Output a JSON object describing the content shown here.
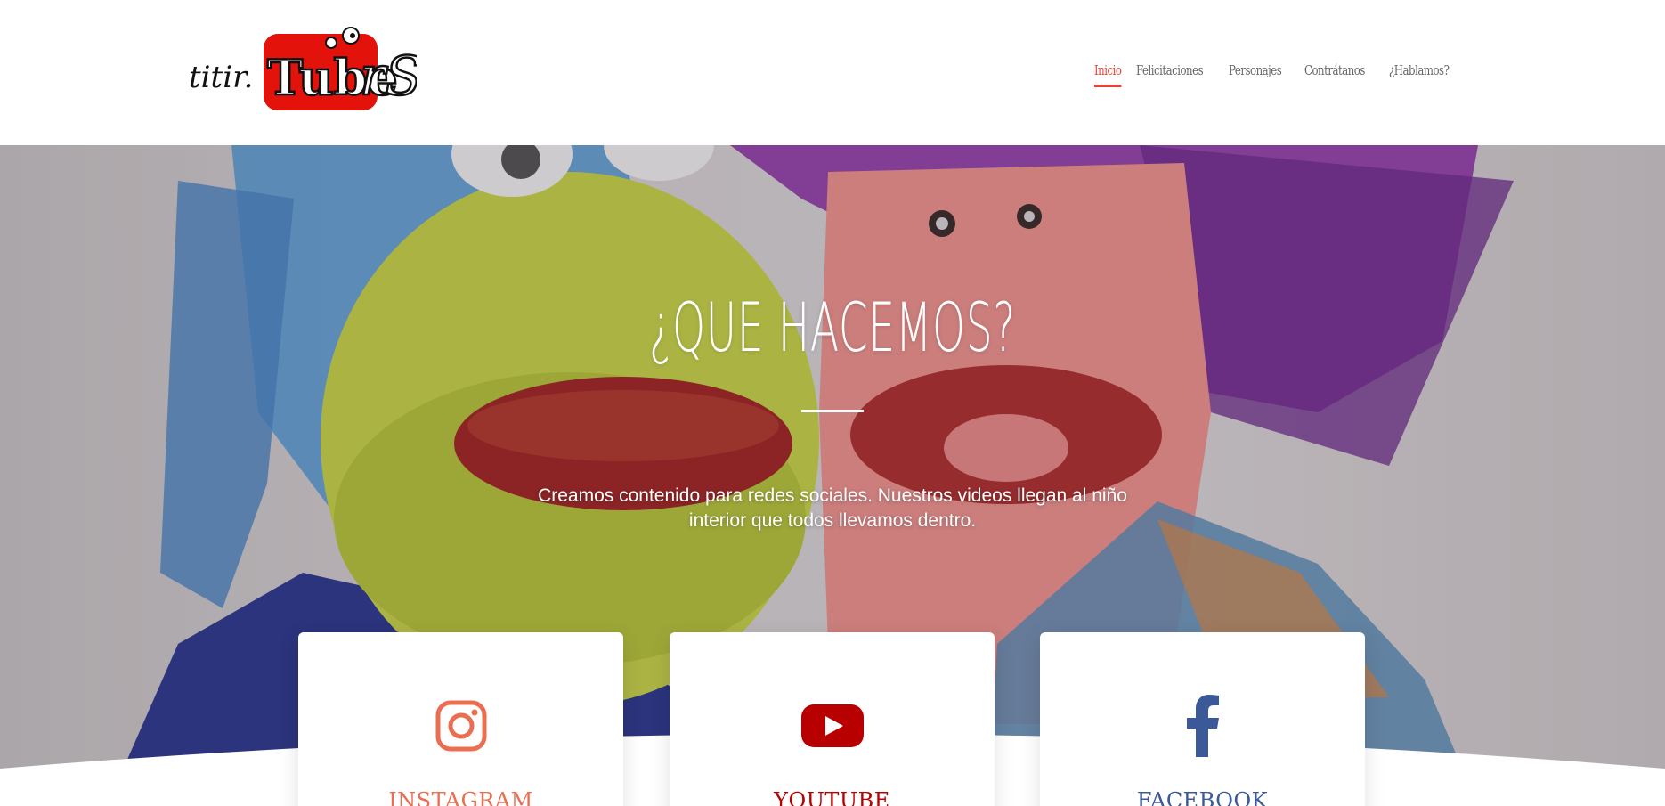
{
  "header": {
    "logo_alt": "Titiritubers",
    "nav": [
      {
        "label": "Inicio",
        "active": true
      },
      {
        "label": "Felicitaciones",
        "active": false
      },
      {
        "label": "Personajes",
        "active": false
      },
      {
        "label": "Contrátanos",
        "active": false
      },
      {
        "label": "¿Hablamos?",
        "active": false
      }
    ],
    "accent_color": "#e8423a"
  },
  "hero": {
    "title": "¿QUE HACEMOS?",
    "text": "Creamos contenido para redes sociales. Nuestros videos llegan al niño interior que todos llevamos dentro."
  },
  "social": [
    {
      "label": "INSTAGRAM",
      "icon": "instagram-icon",
      "color": "#ea6e4f"
    },
    {
      "label": "YOUTUBE",
      "icon": "youtube-icon",
      "color": "#b80000"
    },
    {
      "label": "FACEBOOK",
      "icon": "facebook-icon",
      "color": "#3b5998"
    }
  ]
}
